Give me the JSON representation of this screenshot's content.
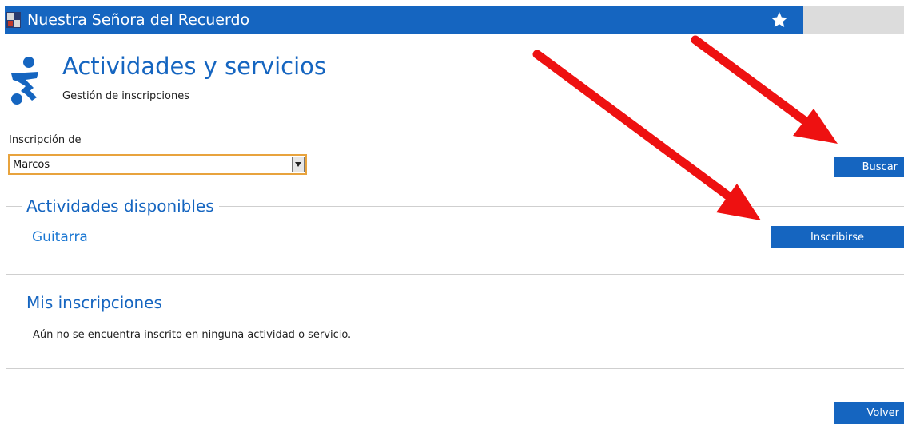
{
  "topbar": {
    "title": "Nuestra Señora del Recuerdo",
    "logo_icon": "school-crest-icon",
    "favorite_icon": "star-icon"
  },
  "header": {
    "title": "Actividades y servicios",
    "subtitle": "Gestión de inscripciones",
    "icon": "sports-player-icon"
  },
  "form": {
    "label": "Inscripción de",
    "selected": "Marcos",
    "search_label": "Buscar"
  },
  "available": {
    "heading": "Actividades disponibles",
    "items": [
      {
        "name": "Guitarra",
        "action_label": "Inscribirse"
      }
    ]
  },
  "mine": {
    "heading": "Mis inscripciones",
    "empty_message": "Aún no se encuentra inscrito en ninguna actividad o servicio."
  },
  "footer": {
    "back_label": "Volver"
  },
  "colors": {
    "brand": "#1565c0",
    "annotation_arrow": "#ee1111",
    "select_border": "#e8a33d"
  }
}
